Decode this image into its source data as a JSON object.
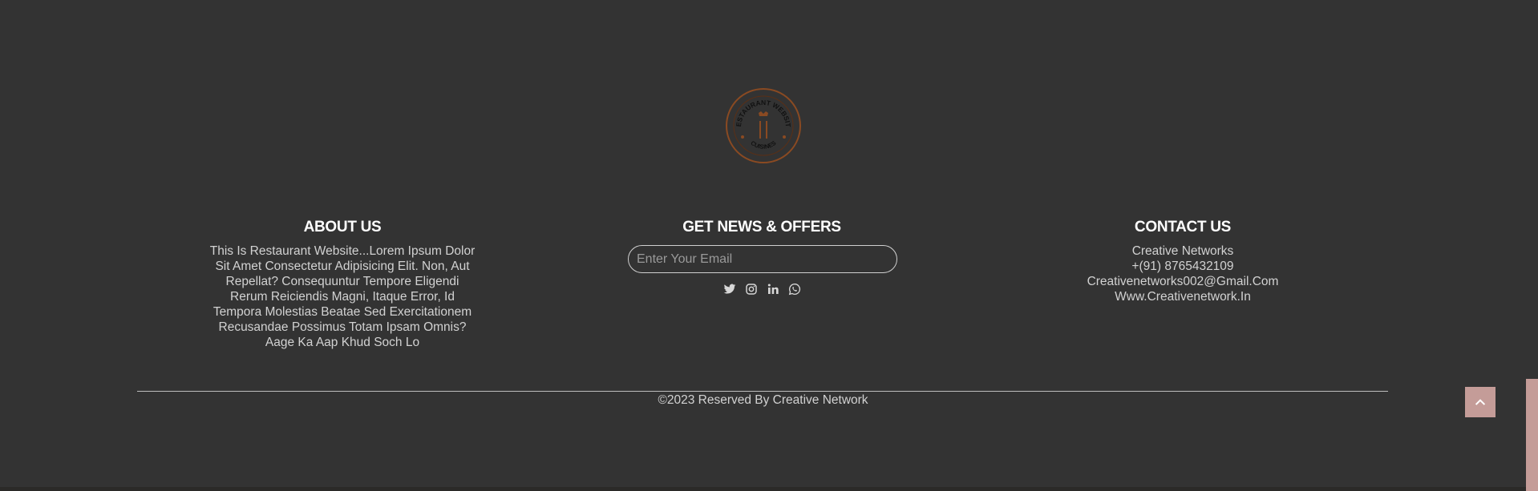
{
  "brand": {
    "logo_top_text": "RESTAURANT WEBSITE",
    "logo_bottom_text": "CUISINES"
  },
  "about": {
    "title": "ABOUT US",
    "text": "This Is Restaurant Website...Lorem Ipsum Dolor Sit Amet Consectetur Adipisicing Elit. Non, Aut Repellat? Consequuntur Tempore Eligendi Rerum Reiciendis Magni, Itaque Error, Id Tempora Molestias Beatae Sed Exercitationem Recusandae Possimus Totam Ipsam Omnis? Aage Ka Aap Khud Soch Lo"
  },
  "news": {
    "title": "GET NEWS & OFFERS",
    "email_placeholder": "Enter Your Email",
    "email_value": "",
    "social_icons": [
      "twitter-icon",
      "instagram-icon",
      "linkedin-icon",
      "whatsapp-icon"
    ]
  },
  "contact": {
    "title": "CONTACT US",
    "company": "Creative Networks",
    "phone": "+(91) 8765432109",
    "email": "Creativenetworks002@Gmail.Com",
    "website": "Www.Creativenetwork.In"
  },
  "footer": {
    "copyright": "©2023 Reserved By Creative Network"
  },
  "ui": {
    "scroll_top_icon": "chevron-up-icon"
  },
  "colors": {
    "background": "#333333",
    "accent": "#c49c98",
    "logo_ring": "#8a4a22",
    "heading": "#ffffff",
    "text": "#d2d2d2"
  }
}
